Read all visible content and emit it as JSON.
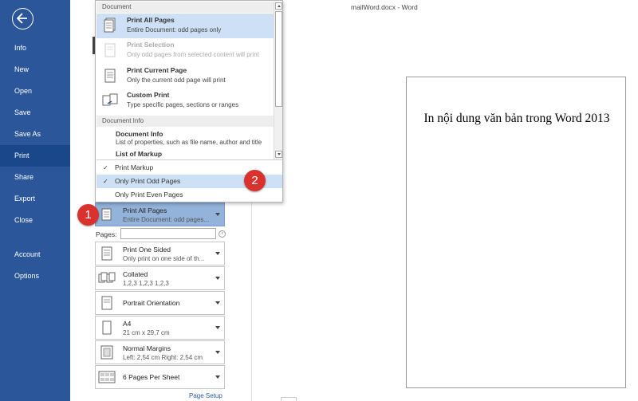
{
  "window": {
    "title": "mailWord.docx - Word"
  },
  "sidebar": {
    "items": [
      {
        "label": "Info"
      },
      {
        "label": "New"
      },
      {
        "label": "Open"
      },
      {
        "label": "Save"
      },
      {
        "label": "Save As"
      },
      {
        "label": "Print",
        "active": true
      },
      {
        "label": "Share"
      },
      {
        "label": "Export"
      },
      {
        "label": "Close"
      },
      {
        "label": "Account"
      },
      {
        "label": "Options"
      }
    ]
  },
  "dropdown": {
    "section_document": "Document",
    "items": [
      {
        "title": "Print All Pages",
        "desc": "Entire Document: odd pages only",
        "icon": "print-all-pages-icon",
        "selected": true
      },
      {
        "title": "Print Selection",
        "desc": "Only odd pages from selected content will print",
        "icon": "print-selection-icon",
        "disabled": true
      },
      {
        "title": "Print Current Page",
        "desc": "Only the current odd page will print",
        "icon": "print-current-page-icon"
      },
      {
        "title": "Custom Print",
        "desc": "Type specific pages, sections or ranges",
        "icon": "custom-print-icon"
      }
    ],
    "section_info": "Document Info",
    "info_items": [
      {
        "title": "Document Info",
        "desc": "List of properties, such as file name, author and title"
      },
      {
        "title": "List of Markup",
        "desc": ""
      }
    ],
    "options": [
      {
        "label": "Print Markup",
        "checked": true
      },
      {
        "label": "Only Print Odd Pages",
        "checked": true,
        "highlighted": true
      },
      {
        "label": "Only Print Even Pages",
        "checked": false
      }
    ]
  },
  "settings": {
    "print_range": {
      "title": "Print All Pages",
      "desc": "Entire Document: odd pages..."
    },
    "pages_label": "Pages:",
    "pages_value": "",
    "sides": {
      "title": "Print One Sided",
      "desc": "Only print on one side of th..."
    },
    "collation": {
      "title": "Collated",
      "desc": "1,2,3    1,2,3    1,2,3"
    },
    "orientation": {
      "title": "Portrait Orientation",
      "desc": ""
    },
    "paper": {
      "title": "A4",
      "desc": "21 cm x 29,7 cm"
    },
    "margins": {
      "title": "Normal Margins",
      "desc": "Left:  2,54 cm    Right:  2,54 cm"
    },
    "per_sheet": {
      "title": "6 Pages Per Sheet",
      "desc": ""
    },
    "page_setup_link": "Page Setup"
  },
  "callouts": [
    "1",
    "2"
  ],
  "preview": {
    "page_text": "In nội dung văn bản trong Word 2013"
  },
  "colors": {
    "sidebar": "#2b579a",
    "sidebar_active": "#19478a",
    "selection": "#93b3db",
    "highlight": "#cde0f5",
    "callout": "#d9322e"
  }
}
